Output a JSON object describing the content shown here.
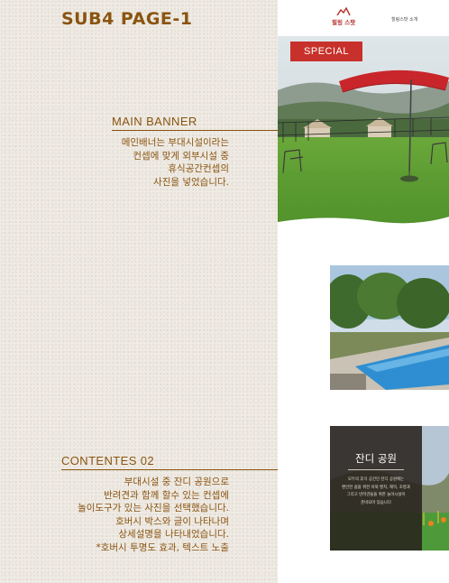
{
  "page": {
    "title": "SUB4 PAGE-1"
  },
  "sections": [
    {
      "heading": "MAIN BANNER",
      "lines": [
        "메인배너는 부대시설이라는",
        "컨셉에 맞게 외부시설 중",
        "휴식공간컨셉의",
        "사진을 넣었습니다."
      ]
    },
    {
      "heading": "CONTENTES 02",
      "lines": [
        "부대시설 중 잔디 공원으로",
        "반려견과 함께 할수 있는 컨셉에",
        "놀이도구가 있는 사진을 선택했습니다.",
        "호버시 박스와 글이 나타나며",
        "상세설명을 나타내었습니다.",
        "*호버시 투명도 효과, 텍스트 노출"
      ]
    }
  ],
  "mockup": {
    "logo_text": "힐링 스팟",
    "nav_link": "힐링스팟 소개",
    "banner_badge": "SPECIAL",
    "panel": {
      "title": "잔디 공원",
      "lines": [
        "모두의 휴식 공간인 잔디 공원에는",
        "편안한 쉼을 위한 야외 벤치, 해먹, 조명과",
        "그리고 반려견들을 위한 놀이시설이",
        "준비되어 있습니다"
      ]
    }
  },
  "colors": {
    "accent": "#8a5410",
    "badge": "#c8312b",
    "panel": "#28221c"
  },
  "icons": [
    "mountain-logo-icon"
  ]
}
